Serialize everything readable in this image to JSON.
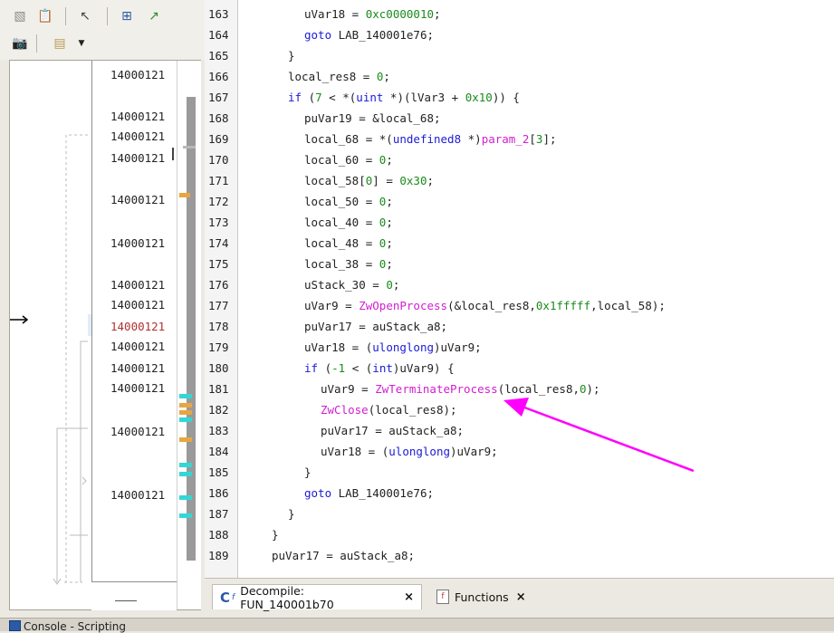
{
  "left_listing": {
    "addresses": [
      "14000121",
      "14000121",
      "14000121",
      "14000121",
      "14000121",
      "14000121",
      "14000121",
      "14000121",
      "14000121",
      "14000121",
      "14000121",
      "14000121",
      "14000121",
      "14000121"
    ]
  },
  "decompiler": {
    "line_numbers": [
      "163",
      "164",
      "165",
      "166",
      "167",
      "168",
      "169",
      "170",
      "171",
      "172",
      "173",
      "174",
      "175",
      "176",
      "177",
      "178",
      "179",
      "180",
      "181",
      "182",
      "183",
      "184",
      "185",
      "186",
      "187",
      "188",
      "189"
    ]
  },
  "tabs": [
    {
      "label": "Decompile: FUN_140001b70",
      "close": "×",
      "active": true
    },
    {
      "label": "Functions",
      "close": "×",
      "active": false
    }
  ],
  "console": {
    "title": "Console - Scripting"
  },
  "colors": {
    "annotation_arrow": "#ff00ff",
    "function_call": "#d11ed1",
    "keyword": "#1b1bd6"
  }
}
